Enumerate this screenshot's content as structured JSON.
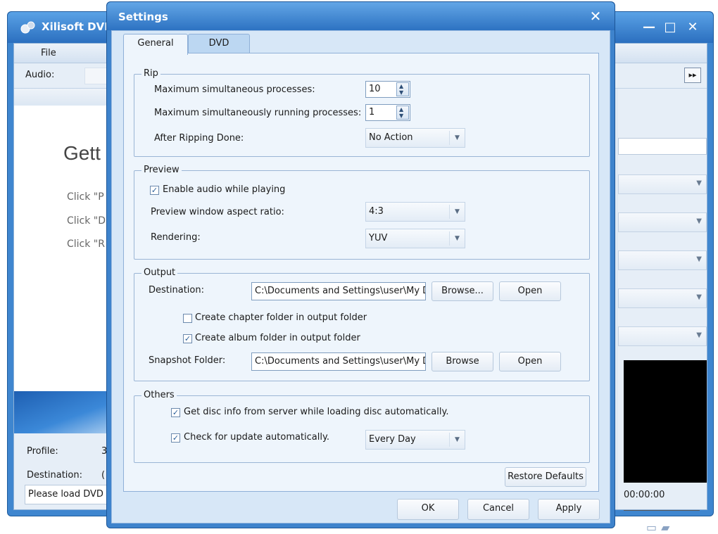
{
  "app": {
    "title": "Xilisoft DVD",
    "menu": {
      "file": "File"
    },
    "toolbar": {
      "audio_label": "Audio:",
      "ff_button": "▸▸"
    },
    "welcome": {
      "heading": "Gett",
      "lines": [
        "Click \"P",
        "Click \"D",
        "Click \"R"
      ]
    },
    "bottom": {
      "profile_label": "Profile:",
      "profile_value": "3",
      "destination_label": "Destination:",
      "destination_value": "(",
      "status": "Please load DVD"
    },
    "preview": {
      "time": "00:00:00"
    },
    "window_controls": {
      "minimize": "—",
      "maximize": "□",
      "close": "✕"
    }
  },
  "dialog": {
    "title": "Settings",
    "close_glyph": "✕",
    "tabs": [
      {
        "label": "General",
        "active": true
      },
      {
        "label": "DVD",
        "active": false
      }
    ],
    "rip": {
      "title": "Rip",
      "max_processes_label": "Maximum simultaneous processes:",
      "max_processes_value": "10",
      "max_running_label": "Maximum simultaneously running processes:",
      "max_running_value": "1",
      "after_ripping_label": "After Ripping Done:",
      "after_ripping_value": "No Action"
    },
    "preview": {
      "title": "Preview",
      "enable_audio_label": "Enable audio while playing",
      "enable_audio_checked": true,
      "aspect_label": "Preview window aspect ratio:",
      "aspect_value": "4:3",
      "rendering_label": "Rendering:",
      "rendering_value": "YUV"
    },
    "output": {
      "title": "Output",
      "destination_label": "Destination:",
      "destination_value": "C:\\Documents and Settings\\user\\My D",
      "browse_label": "Browse...",
      "open_label": "Open",
      "chapter_folder_label": "Create chapter folder in output folder",
      "chapter_folder_checked": false,
      "album_folder_label": "Create album folder in output folder",
      "album_folder_checked": true,
      "snapshot_label": "Snapshot Folder:",
      "snapshot_value": "C:\\Documents and Settings\\user\\My D",
      "snapshot_browse_label": "Browse",
      "snapshot_open_label": "Open"
    },
    "others": {
      "title": "Others",
      "disc_info_label": "Get disc info from server while loading disc automatically.",
      "disc_info_checked": true,
      "update_label": "Check for update automatically.",
      "update_checked": true,
      "update_frequency": "Every Day"
    },
    "restore_defaults_label": "Restore Defaults",
    "ok_label": "OK",
    "cancel_label": "Cancel",
    "apply_label": "Apply",
    "check_glyph": "✓",
    "spin_up": "▲",
    "spin_down": "▼",
    "combo_arrow": "▼"
  },
  "colors": {
    "title_bar": "#2d72c2",
    "dialog_body": "#d7e7f7",
    "panel": "#eef5fc",
    "group_border": "#9ab5d5"
  }
}
